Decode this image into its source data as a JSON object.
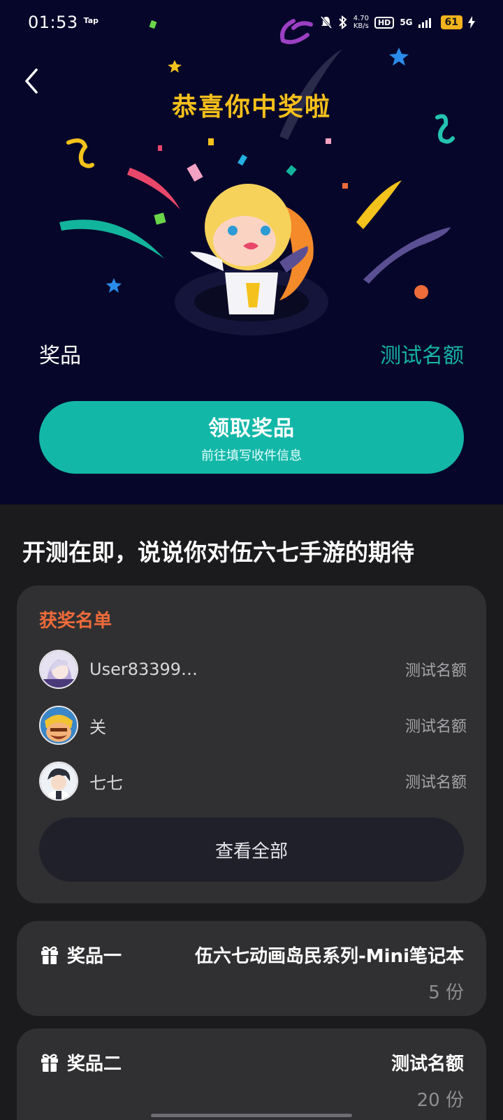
{
  "status_bar": {
    "time": "01:53",
    "tap_label": "Tap",
    "speed_value": "4.70",
    "speed_unit": "KB/s",
    "hd": "HD",
    "network": "5G",
    "battery": "61"
  },
  "hero": {
    "title": "恭喜你中奖啦",
    "prize_label": "奖品",
    "prize_value": "测试名额",
    "claim_button": {
      "title": "领取奖品",
      "subtitle": "前往填写收件信息"
    }
  },
  "section": {
    "heading": "开测在即，说说你对伍六七手游的期待"
  },
  "winners": {
    "title": "获奖名单",
    "list": [
      {
        "name": "User83399…",
        "prize": "测试名额",
        "avatar_icon": "anime-girl-avatar"
      },
      {
        "name": "关",
        "prize": "测试名额",
        "avatar_icon": "barbarian-avatar"
      },
      {
        "name": "七七",
        "prize": "测试名额",
        "avatar_icon": "anime-boy-avatar"
      }
    ],
    "view_all": "查看全部"
  },
  "prizes": [
    {
      "label": "奖品一",
      "name": "伍六七动画岛民系列-Mini笔记本",
      "quantity": "5 份"
    },
    {
      "label": "奖品二",
      "name": "测试名额",
      "quantity": "20 份"
    }
  ],
  "colors": {
    "hero_bg": "#06062a",
    "accent": "#13b7a8",
    "title_gold": "#f7c01b",
    "winners_title": "#ee6b3a"
  }
}
